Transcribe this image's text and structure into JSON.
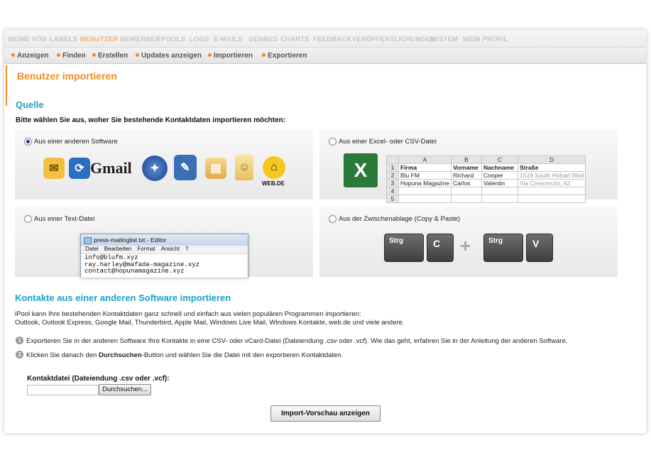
{
  "topnav": [
    "MEINE VÖS",
    "LABELS",
    "BENUTZER",
    "BEWERBER",
    "POOLS",
    "LOGS",
    "E-MAILS",
    "GENRES",
    "CHARTS",
    "FEEDBACK",
    "VERÖFFENTLICHUNGEN",
    "SYSTEM",
    "MEIN PROFIL"
  ],
  "subnav": [
    "Anzeigen",
    "Finden",
    "Erstellen",
    "Updates anzeigen",
    "Importieren",
    "Exportieren"
  ],
  "page_title": "Benutzer importieren",
  "source": {
    "heading": "Quelle",
    "prompt": "Bitte wählen Sie aus, woher Sie bestehende Kontaktdaten importieren möchten:",
    "option_software": "Aus einer anderen Software",
    "option_excel": "Aus einer Excel- oder CSV-Datei",
    "option_text": "Aus einer Text-Datei",
    "option_clipboard": "Aus der Zwischenablage (Copy & Paste)"
  },
  "logos": {
    "gmail": "Gmail",
    "webde": "WEB.DE"
  },
  "sheet": {
    "col_headers": [
      "A",
      "B",
      "C",
      "D"
    ],
    "rows": [
      {
        "n": "1",
        "cells": [
          "Firma",
          "Vorname",
          "Nachname",
          "Straße"
        ]
      },
      {
        "n": "2",
        "cells": [
          "Blu FM",
          "Richard",
          "Cooper",
          "1519 South Hobart Blvd"
        ]
      },
      {
        "n": "3",
        "cells": [
          "Hopuna Magazine",
          "Carlos",
          "Valentin",
          "Via Crescenzio, 42"
        ]
      },
      {
        "n": "4",
        "cells": [
          "",
          "",
          "",
          ""
        ]
      },
      {
        "n": "5",
        "cells": [
          "",
          "",
          "",
          ""
        ]
      }
    ]
  },
  "editor": {
    "title": "press-mailinglist.txt - Editor",
    "menu": [
      "Datei",
      "Bearbeiten",
      "Format",
      "Ansicht",
      "?"
    ],
    "lines": [
      "info@blufm.xyz",
      "ray.harley@mafada-magazine.xyz",
      "contact@hopunamagazine.xyz"
    ]
  },
  "keys": {
    "k1": "Strg",
    "k2": "C",
    "k3": "Strg",
    "k4": "V"
  },
  "import": {
    "heading": "Kontakte aus einer anderen Software importieren",
    "intro1": "iPool kann Ihre bestehenden Kontaktdaten ganz schnell und einfach aus vielen populären Programmen importieren:",
    "intro2": "Outlook, Outlook Express, Google Mail, Thunderbird, Apple Mail, Windows Live Mail, Windows Kontakte, web.de und viele andere.",
    "step1": "Exportieren Sie in der anderen Software Ihre Kontakte in eine CSV- oder vCard-Datei (Dateiendung .csv oder .vcf). Wie das geht, erfahren Sie in der Anleitung der anderen Software.",
    "step2_a": "Klicken Sie danach den ",
    "step2_b": "Durchsuchen",
    "step2_c": "-Button und wählen Sie die Datei mit den exportieren Kontaktdaten.",
    "file_label": "Kontaktdatei (Dateiendung .csv oder .vcf):",
    "browse_label": "Durchsuchen...",
    "submit_label": "Import-Vorschau anzeigen"
  }
}
